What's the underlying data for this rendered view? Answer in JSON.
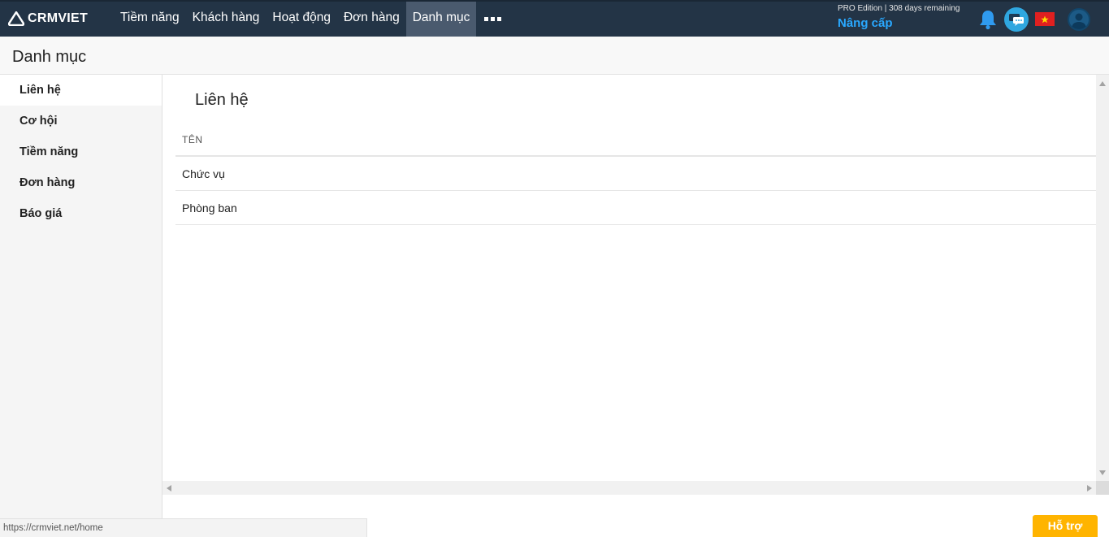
{
  "brand": {
    "name": "CRMVIET"
  },
  "nav": {
    "items": [
      {
        "label": "Tiềm năng",
        "active": false
      },
      {
        "label": "Khách hàng",
        "active": false
      },
      {
        "label": "Hoạt động",
        "active": false
      },
      {
        "label": "Đơn hàng",
        "active": false
      },
      {
        "label": "Danh mục",
        "active": true
      }
    ],
    "more_icon": "ellipsis-icon"
  },
  "account": {
    "edition": "PRO Edition | 308 days remaining",
    "upgrade_label": "Nâng cấp"
  },
  "header_icons": [
    "bell-icon",
    "chat-icon",
    "vietnam-flag-icon",
    "user-avatar-icon"
  ],
  "page": {
    "title": "Danh mục"
  },
  "sidebar": {
    "items": [
      {
        "label": "Liên hệ",
        "active": true
      },
      {
        "label": "Cơ hội",
        "active": false
      },
      {
        "label": "Tiềm năng",
        "active": false
      },
      {
        "label": "Đơn hàng",
        "active": false
      },
      {
        "label": "Báo giá",
        "active": false
      }
    ]
  },
  "main": {
    "title": "Liên hệ",
    "table": {
      "header": "TÊN",
      "rows": [
        "Chức vụ",
        "Phòng ban"
      ]
    }
  },
  "status_url": "https://crmviet.net/home",
  "help": {
    "label": "Hỗ trợ"
  },
  "colors": {
    "topbar": "#233446",
    "active_nav": "#4a5a6e",
    "upgrade": "#29a8ff",
    "help": "#ffb400"
  }
}
